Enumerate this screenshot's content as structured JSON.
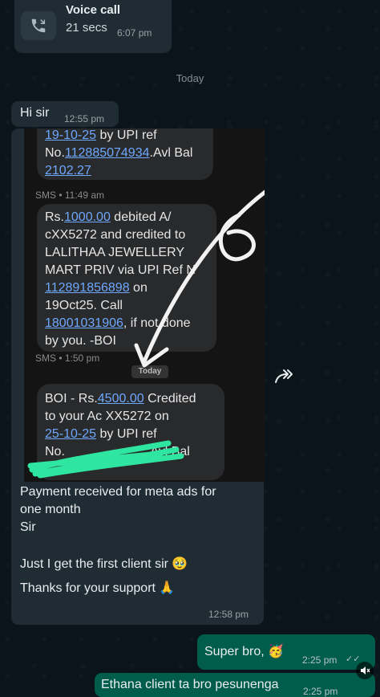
{
  "call": {
    "title": "Voice call",
    "duration": "21 secs",
    "time": "6:07 pm"
  },
  "date_divider": "Today",
  "hi_message": {
    "text": "Hi sir",
    "time": "12:55 pm"
  },
  "screenshot": {
    "sms1_lines": [
      "19-10-25",
      " by UPI ref",
      "No.",
      "112885074934",
      ".Avl Bal",
      "2102.27"
    ],
    "sms1_meta": "SMS • 11:49 am",
    "sms2": {
      "l1a": "Rs.",
      "l1b": "1000.00",
      "l1c": " debited A/",
      "l2": "cXX5272 and credited to",
      "l3": "LALITHAA JEWELLERY",
      "l4": "MART PRIV via UPI Ref N",
      "l5a": "112891856898",
      "l5b": " on",
      "l6": "19Oct25. Call",
      "l7a": "18001031906",
      "l7b": ", if not done",
      "l8": "by you. -BOI"
    },
    "sms2_meta": "SMS • 1:50 pm",
    "today_chip": "Today",
    "sms3": {
      "l1a": "BOI -  Rs.",
      "l1b": "4500.00",
      "l1c": " Credited",
      "l2": "to your Ac XX5272 on",
      "l3a": "25-10-25",
      "l3b": " by UPI ref",
      "l4a": "No.",
      "l4b": ".Avl Bal"
    }
  },
  "caption": {
    "line1": "Payment received  for meta ads for",
    "line2": "one month",
    "line3": "Sir",
    "line4": "Just I get the first client sir 🥹",
    "line5": "Thanks for your support 🙏",
    "time": "12:58 pm"
  },
  "outgoing": [
    {
      "text": "Super bro, 🥳",
      "time": "2:25 pm",
      "status": "✓✓"
    },
    {
      "text": "Ethana client ta bro pesunenga",
      "time": "2:25 pm"
    }
  ],
  "icons": {
    "call": "phone-icon",
    "forward": "forward-icon",
    "mute": "mute-icon"
  }
}
